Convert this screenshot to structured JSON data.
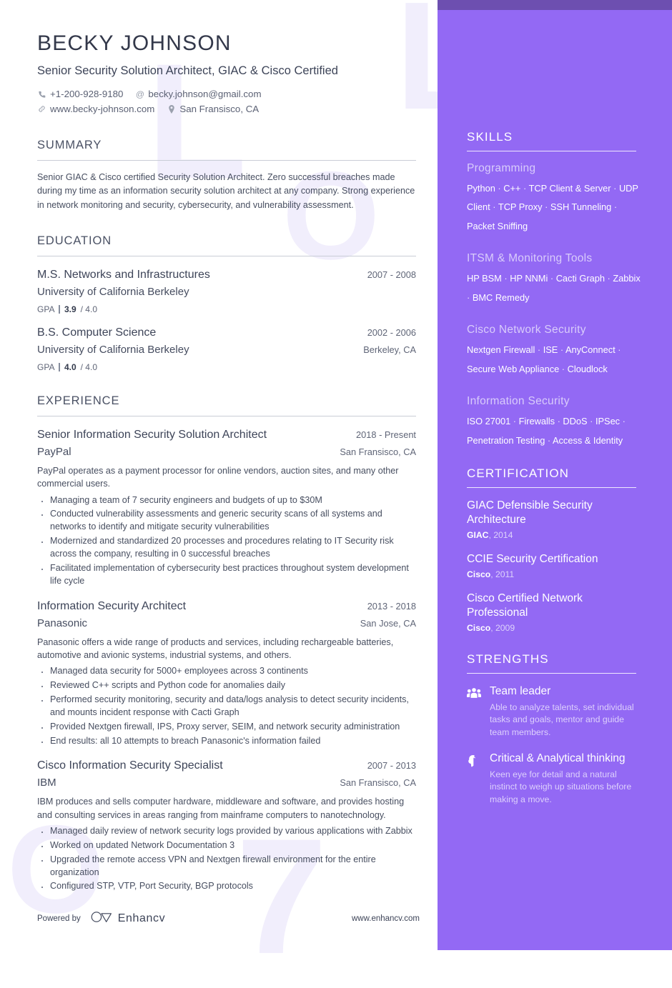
{
  "theme": {
    "sidebar_bg": "#9369f4",
    "sidebar_top_band": "#6d4fb0",
    "watermark": "#f1eefc",
    "text_dark": "#3c4257"
  },
  "watermarks": [
    "L",
    "L",
    "O",
    "O",
    "7"
  ],
  "header": {
    "name": "BECKY JOHNSON",
    "role": "Senior Security Solution Architect, GIAC & Cisco Certified",
    "contacts": {
      "phone": "+1-200-928-9180",
      "email": "becky.johnson@gmail.com",
      "website": "www.becky-johnson.com",
      "location": "San Fransisco, CA"
    }
  },
  "summary": {
    "title": "SUMMARY",
    "text": "Senior GIAC & Cisco certified Security Solution Architect. Zero successful breaches made during my time as an information security solution architect at any company. Strong experience in network monitoring and security, cybersecurity, and vulnerability assessment."
  },
  "education": {
    "title": "EDUCATION",
    "entries": [
      {
        "degree": "M.S. Networks and Infrastructures",
        "date": "2007 - 2008",
        "school": "University of California Berkeley",
        "location": "",
        "gpa_label": "GPA",
        "gpa_value": "3.9",
        "gpa_scale": "/ 4.0"
      },
      {
        "degree": "B.S. Computer Science",
        "date": "2002 - 2006",
        "school": "University of California Berkeley",
        "location": "Berkeley, CA",
        "gpa_label": "GPA",
        "gpa_value": "4.0",
        "gpa_scale": "/ 4.0"
      }
    ]
  },
  "experience": {
    "title": "EXPERIENCE",
    "entries": [
      {
        "job_title": "Senior Information Security Solution Architect",
        "date": "2018 - Present",
        "company": "PayPal",
        "location": "San Fransisco, CA",
        "description": "PayPal operates as a payment processor for online vendors, auction sites, and many other commercial users.",
        "bullets": [
          "Managing a team of 7 security engineers and budgets of up to $30M",
          "Conducted vulnerability assessments and generic security scans of all systems and networks to identify and mitigate security vulnerabilities",
          "Modernized and standardized 20 processes and procedures relating to IT Security risk across the company, resulting in 0 successful breaches",
          "Facilitated implementation of cybersecurity best practices throughout system development life cycle"
        ]
      },
      {
        "job_title": "Information Security Architect",
        "date": "2013 - 2018",
        "company": "Panasonic",
        "location": "San Jose, CA",
        "description": "Panasonic offers a wide range of products and services, including rechargeable batteries, automotive and avionic systems, industrial systems, and others.",
        "bullets": [
          "Managed data security for 5000+ employees across 3 continents",
          "Reviewed C++ scripts and Python code for anomalies daily",
          "Performed security monitoring, security and data/logs analysis to detect security incidents, and mounts incident response with Cacti Graph",
          "Provided Nextgen firewall, IPS, Proxy server, SEIM, and network security administration",
          "End results: all 10 attempts to breach Panasonic's information failed"
        ]
      },
      {
        "job_title": "Cisco Information Security Specialist",
        "date": "2007 - 2013",
        "company": "IBM",
        "location": "San Fransisco, CA",
        "description": "IBM produces and sells computer hardware, middleware and software, and provides hosting and consulting services in areas ranging from mainframe computers to nanotechnology.",
        "bullets": [
          "Managed daily review of network security logs provided by various applications with Zabbix",
          "Worked on updated Network Documentation 3",
          "Upgraded the remote access VPN and Nextgen firewall environment for the entire organization",
          "Configured STP, VTP, Port Security, BGP protocols"
        ]
      }
    ]
  },
  "skills": {
    "title": "SKILLS",
    "groups": [
      {
        "name": "Programming",
        "items": [
          "Python",
          "C++",
          "TCP Client & Server",
          "UDP Client",
          "TCP Proxy",
          "SSH Tunneling",
          "Packet Sniffing"
        ]
      },
      {
        "name": "ITSM & Monitoring Tools",
        "items": [
          "HP BSM",
          "HP NNMi",
          "Cacti Graph",
          "Zabbix",
          "BMC Remedy"
        ]
      },
      {
        "name": "Cisco Network Security",
        "items": [
          "Nextgen Firewall",
          "ISE",
          "AnyConnect",
          "Secure Web Appliance",
          "Cloudlock"
        ]
      },
      {
        "name": "Information Security",
        "items": [
          "ISO 27001",
          "Firewalls",
          "DDoS",
          "IPSec",
          "Penetration Testing",
          "Access & Identity"
        ]
      }
    ]
  },
  "certification": {
    "title": "CERTIFICATION",
    "entries": [
      {
        "name": "GIAC Defensible Security Architecture",
        "issuer": "GIAC",
        "year": "2014"
      },
      {
        "name": "CCIE Security Certification",
        "issuer": "Cisco",
        "year": "2011"
      },
      {
        "name": "Cisco Certified Network Professional",
        "issuer": "Cisco",
        "year": "2009"
      }
    ]
  },
  "strengths": {
    "title": "STRENGTHS",
    "items": [
      {
        "icon": "users-group-icon",
        "title": "Team leader",
        "description": "Able to analyze talents, set individual tasks and goals, mentor and guide team members."
      },
      {
        "icon": "brain-icon",
        "title": "Critical & Analytical thinking",
        "description": "Keen eye for detail and a natural instinct to weigh up situations before making a move."
      }
    ]
  },
  "footer": {
    "powered_by": "Powered by",
    "brand": "Enhancv",
    "url": "www.enhancv.com"
  }
}
